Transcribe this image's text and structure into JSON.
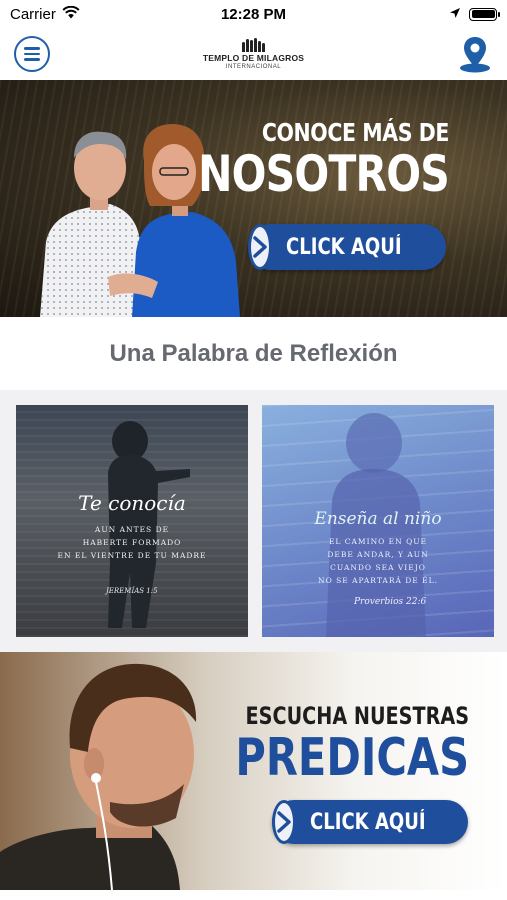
{
  "status_bar": {
    "carrier": "Carrier",
    "time": "12:28 PM"
  },
  "nav": {
    "logo_name": "TEMPLO DE MILAGROS",
    "logo_sub": "INTERNACIONAL"
  },
  "hero": {
    "line1": "CONOCE MÁS DE",
    "line2": "NOSOTROS",
    "cta": "CLICK AQUÍ"
  },
  "section": {
    "title": "Una Palabra de Reflexión"
  },
  "cards": [
    {
      "script": "Te conocía",
      "lines": [
        "AUN ANTES DE",
        "HABERTE FORMADO",
        "EN EL VIENTRE DE TU MADRE"
      ],
      "ref": "JEREMÍAS 1:5"
    },
    {
      "script": "Enseña al niño",
      "lines": [
        "EL CAMINO EN QUE",
        "DEBE ANDAR, Y AUN",
        "CUANDO SEA VIEJO",
        "NO SE APARTARÁ DE ÉL."
      ],
      "ref": "Proverbios 22:6"
    }
  ],
  "banner2": {
    "line1": "ESCUCHA NUESTRAS",
    "line2": "PREDICAS",
    "cta": "CLICK AQUÍ"
  },
  "colors": {
    "brand_blue": "#1f4f9c",
    "nav_blue": "#1f5fa8",
    "section_title": "#666a70"
  },
  "icons": {
    "menu": "hamburger-menu-icon",
    "location": "location-pin-icon",
    "cta": "chevron-right-icon"
  }
}
